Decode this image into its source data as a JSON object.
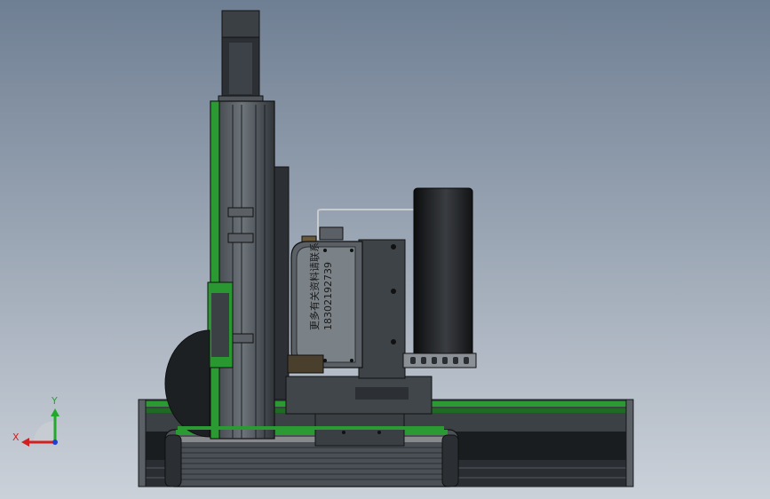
{
  "viewport": {
    "background_top": "#6f7f93",
    "background_bottom": "#cbd1d9"
  },
  "model": {
    "label_line1": "更多有关资料请联系",
    "label_line2": "18302192739"
  },
  "triad": {
    "x_label": "X",
    "y_label": "Y",
    "x_color": "#d21f1f",
    "y_color": "#22a82b",
    "z_color": "#1f3fd2"
  },
  "colors": {
    "metal_dark": "#2e3338",
    "metal_mid": "#4b5157",
    "metal_light": "#7e858b",
    "green_rail": "#2f9a33",
    "black": "#101214"
  }
}
